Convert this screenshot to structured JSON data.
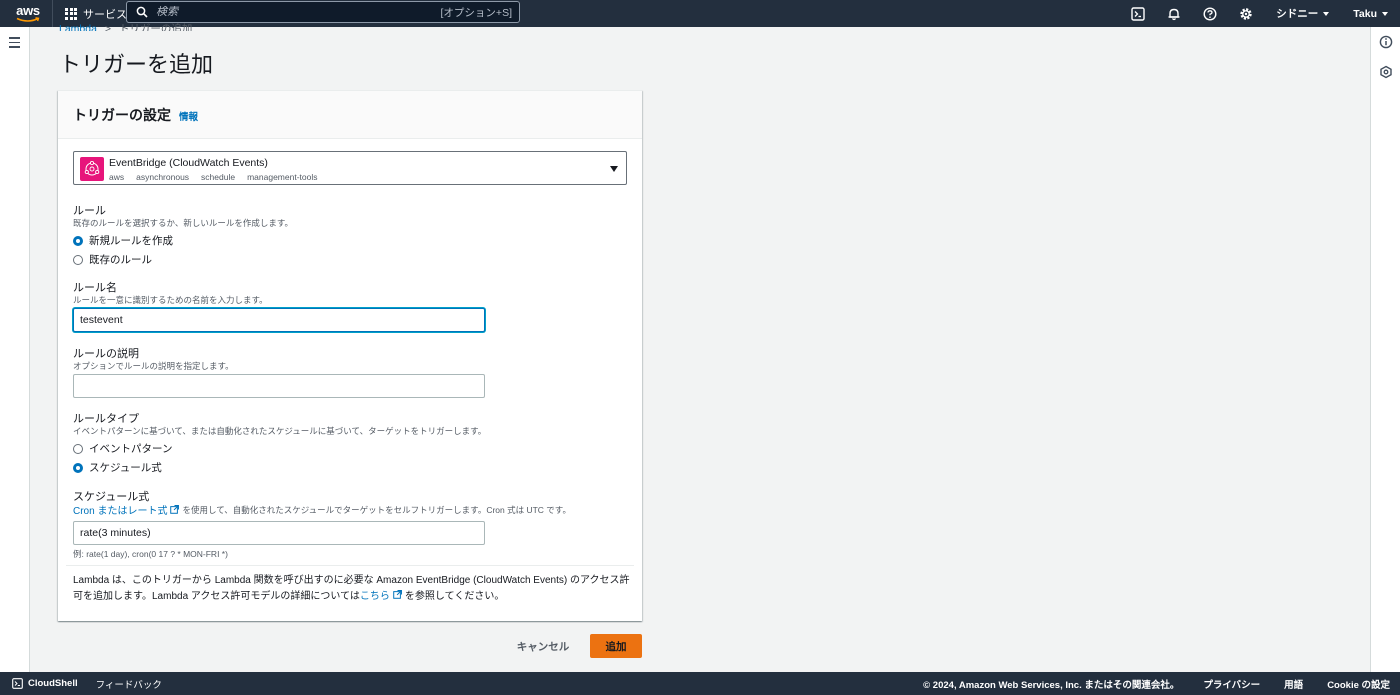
{
  "topnav": {
    "logo_text": "aws",
    "services_label": "サービス",
    "search_placeholder": "検索",
    "search_shortcut": "[オプション+S]",
    "region": "シドニー",
    "user": "Taku"
  },
  "breadcrumb": {
    "root": "Lambda",
    "separator": ">",
    "current": "トリガーの追加"
  },
  "page_title": "トリガーを追加",
  "trigger_config": {
    "heading": "トリガーの設定",
    "info_link": "情報",
    "source": {
      "title": "EventBridge (CloudWatch Events)",
      "tags": [
        "aws",
        "asynchronous",
        "schedule",
        "management-tools"
      ]
    },
    "rule": {
      "label": "ルール",
      "description": "既存のルールを選択するか、新しいルールを作成します。",
      "options": [
        "新規ルールを作成",
        "既存のルール"
      ],
      "selected": "新規ルールを作成"
    },
    "rule_name": {
      "label": "ルール名",
      "description": "ルールを一意に識別するための名前を入力します。",
      "value": "testevent"
    },
    "rule_description": {
      "label": "ルールの説明",
      "description": "オプションでルールの説明を指定します。",
      "value": ""
    },
    "rule_type": {
      "label": "ルールタイプ",
      "description": "イベントパターンに基づいて、または自動化されたスケジュールに基づいて、ターゲットをトリガーします。",
      "options": [
        "イベントパターン",
        "スケジュール式"
      ],
      "selected": "スケジュール式"
    },
    "schedule_expression": {
      "label": "スケジュール式",
      "link_text": "Cron またはレート式",
      "description_suffix": "を使用して、自動化されたスケジュールでターゲットをセルフトリガーします。Cron 式は UTC です。",
      "value": "rate(3 minutes)",
      "hint": "例: rate(1 day), cron(0 17 ? * MON-FRI *)"
    },
    "permission_note": {
      "text_before": "Lambda は、このトリガーから Lambda 関数を呼び出すのに必要な Amazon EventBridge (CloudWatch Events) のアクセス許可を追加します。Lambda アクセス許可モデルの詳細については",
      "link_text": "こちら",
      "text_after": "を参照してください。"
    }
  },
  "actions": {
    "cancel": "キャンセル",
    "add": "追加"
  },
  "footer": {
    "cloudshell": "CloudShell",
    "feedback": "フィードバック",
    "copyright": "© 2024, Amazon Web Services, Inc. またはその関連会社。",
    "privacy": "プライバシー",
    "terms": "用語",
    "cookie": "Cookie の設定"
  },
  "colors": {
    "nav_bg": "#232f3e",
    "link": "#0073bb",
    "primary_button": "#ec7211",
    "eventbridge_icon": "#e7157b"
  }
}
